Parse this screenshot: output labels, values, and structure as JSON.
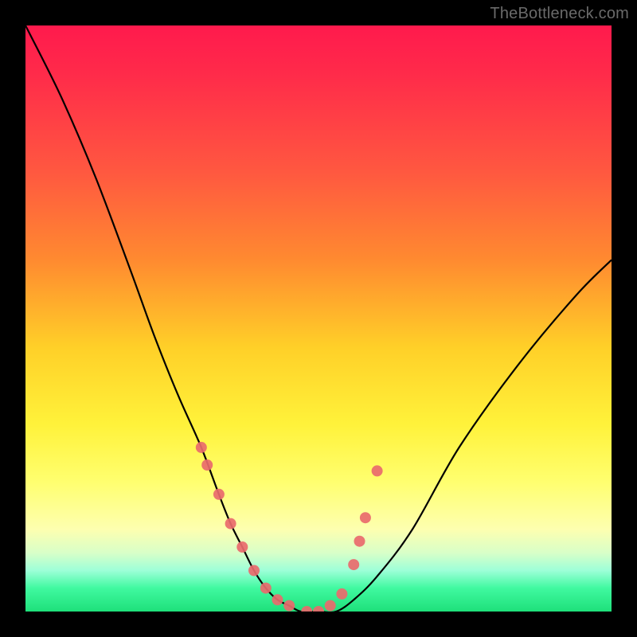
{
  "watermark": "TheBottleneck.com",
  "colors": {
    "frame": "#000000",
    "curve": "#000000",
    "marker": "#e96a6d",
    "gradient_stops": [
      "#ff1a4d",
      "#ff2a4a",
      "#ff5840",
      "#ff8a30",
      "#ffd028",
      "#fff23a",
      "#ffff70",
      "#fdffb0",
      "#d8ffc8",
      "#9dffd8",
      "#40f9a0",
      "#1ee07a"
    ]
  },
  "chart_data": {
    "type": "line",
    "title": "",
    "xlabel": "",
    "ylabel": "",
    "xlim": [
      0,
      100
    ],
    "ylim": [
      0,
      100
    ],
    "grid": false,
    "legend": false,
    "series": [
      {
        "name": "bottleneck-curve",
        "x": [
          0,
          6,
          12,
          18,
          22,
          26,
          30,
          33,
          35,
          37,
          39,
          41,
          43,
          45,
          47,
          50,
          53,
          56,
          60,
          66,
          74,
          84,
          94,
          100
        ],
        "y": [
          100,
          88,
          74,
          58,
          47,
          37,
          28,
          20,
          15,
          11,
          7,
          4,
          2,
          1,
          0,
          0,
          0,
          2,
          6,
          14,
          28,
          42,
          54,
          60
        ]
      }
    ],
    "markers": {
      "name": "highlight-points",
      "x": [
        30,
        31,
        33,
        35,
        37,
        39,
        41,
        43,
        45,
        48,
        50,
        52,
        54,
        56,
        57,
        58,
        60
      ],
      "y": [
        28,
        25,
        20,
        15,
        11,
        7,
        4,
        2,
        1,
        0,
        0,
        1,
        3,
        8,
        12,
        16,
        24
      ]
    }
  }
}
